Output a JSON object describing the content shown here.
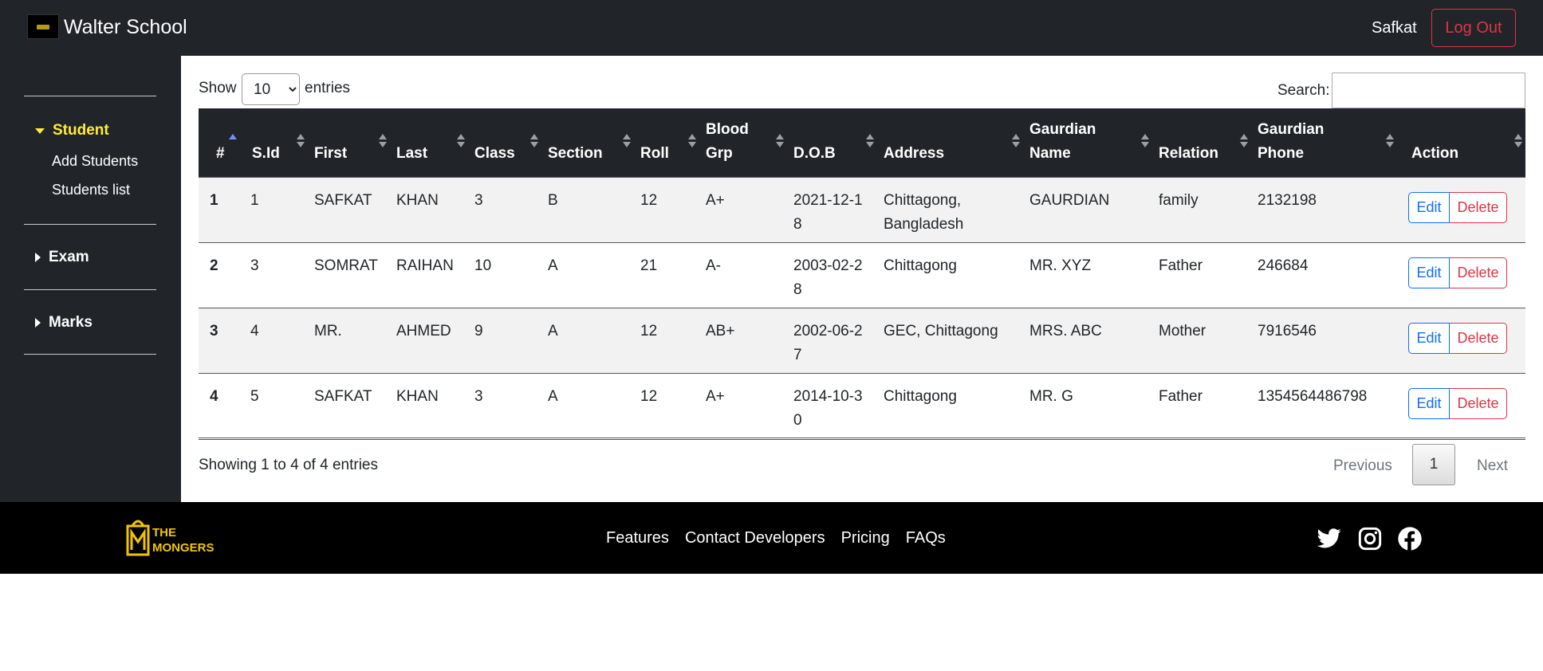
{
  "navbar": {
    "brand": "Walter School",
    "user": "Safkat",
    "logout_label": "Log Out"
  },
  "sidebar": {
    "groups": [
      {
        "label": "Student",
        "expanded": true,
        "items": [
          "Add Students",
          "Students list"
        ]
      },
      {
        "label": "Exam",
        "expanded": false
      },
      {
        "label": "Marks",
        "expanded": false
      }
    ]
  },
  "table_controls": {
    "show_label": "Show",
    "page_size": "10",
    "entries_label": "entries",
    "search_label": "Search:",
    "search_value": ""
  },
  "table": {
    "columns": [
      "#",
      "S.Id",
      "First",
      "Last",
      "Class",
      "Section",
      "Roll",
      "Blood Grp",
      "D.O.B",
      "Address",
      "Gaurdian Name",
      "Relation",
      "Gaurdian Phone",
      "Action"
    ],
    "rows": [
      [
        "1",
        "1",
        "SAFKAT",
        "KHAN",
        "3",
        "B",
        "12",
        "A+",
        "2021-12-18",
        "Chittagong, Bangladesh",
        "GAURDIAN",
        "family",
        "2132198"
      ],
      [
        "2",
        "3",
        "SOMRAT",
        "RAIHAN",
        "10",
        "A",
        "21",
        "A-",
        "2003-02-28",
        "Chittagong",
        "MR. XYZ",
        "Father",
        "246684"
      ],
      [
        "3",
        "4",
        "MR.",
        "AHMED",
        "9",
        "A",
        "12",
        "AB+",
        "2002-06-27",
        "GEC, Chittagong",
        "MRS. ABC",
        "Mother",
        "7916546"
      ],
      [
        "4",
        "5",
        "SAFKAT",
        "KHAN",
        "3",
        "A",
        "12",
        "A+",
        "2014-10-30",
        "Chittagong",
        "MR. G",
        "Father",
        "1354564486798"
      ]
    ],
    "edit_label": "Edit",
    "delete_label": "Delete"
  },
  "pagination": {
    "info": "Showing 1 to 4 of 4 entries",
    "previous": "Previous",
    "current_page": "1",
    "next": "Next"
  },
  "footer": {
    "logo_text_1": "THE",
    "logo_text_2": "MONGERS",
    "links": [
      "Features",
      "Contact Developers",
      "Pricing",
      "FAQs"
    ],
    "social_icons": [
      "twitter-icon",
      "instagram-icon",
      "facebook-icon"
    ]
  },
  "colors": {
    "dark": "#212529",
    "active_sidebar": "#ffeb3b",
    "edit": "#0d6efd",
    "delete": "#dc3545",
    "footer_logo": "#f2c400"
  }
}
